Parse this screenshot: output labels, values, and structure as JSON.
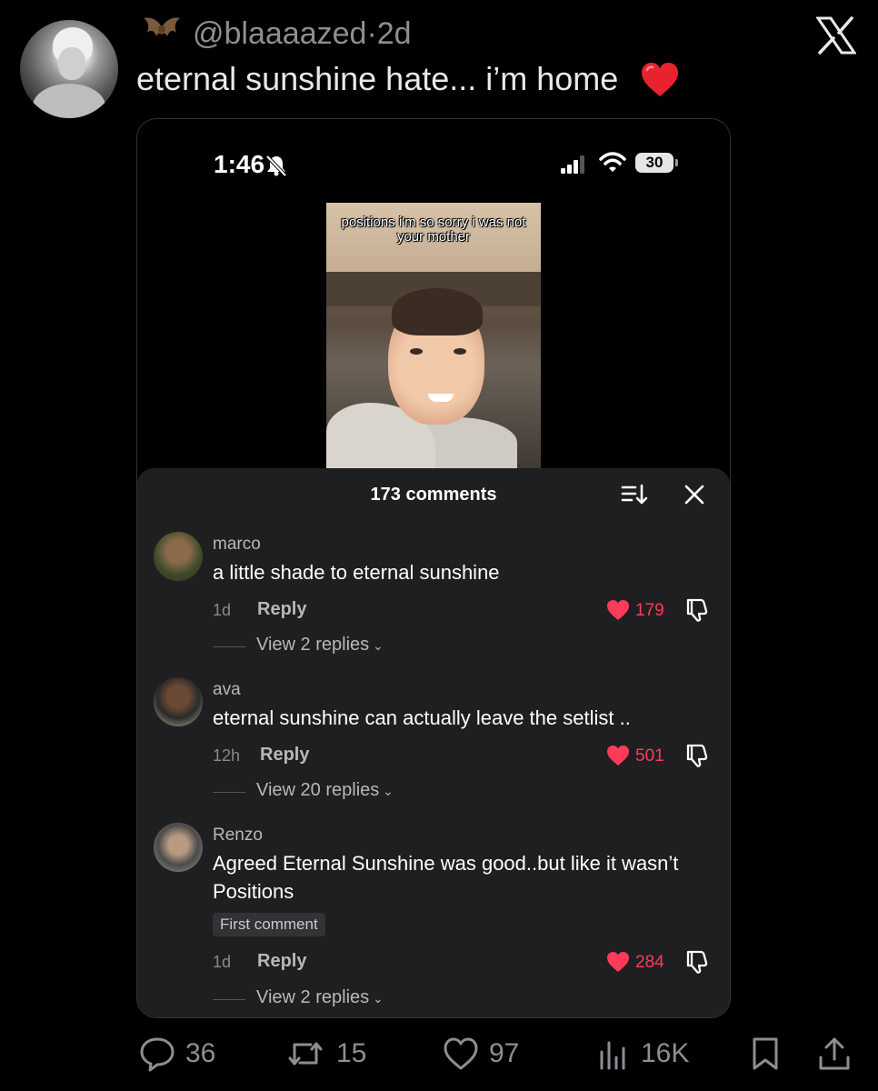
{
  "tweet": {
    "handle": "@blaaaazed",
    "separator": "·",
    "age": "2d",
    "text": "eternal sunshine hate... i’m home",
    "emoji_icon": "red-heart-emoji"
  },
  "screenshot": {
    "status_bar": {
      "time": "1:46",
      "battery": "30"
    },
    "video": {
      "caption": "positions i'm so sorry i was not your mother"
    },
    "comments_panel": {
      "count_label": "173 comments",
      "comments": [
        {
          "user": "marco",
          "text": "a little shade to eternal sunshine",
          "time": "1d",
          "reply_label": "Reply",
          "likes": "179",
          "view_replies": "View 2 replies"
        },
        {
          "user": "ava",
          "text": "eternal sunshine can actually leave the setlist ..",
          "time": "12h",
          "reply_label": "Reply",
          "likes": "501",
          "view_replies": "View 20 replies"
        },
        {
          "user": "Renzo",
          "text_line1": "Agreed Eternal Sunshine was good..but like it wasn’t",
          "text_line2": "Positions",
          "badge": "First comment",
          "time": "1d",
          "reply_label": "Reply",
          "likes": "284",
          "view_replies": "View 2 replies"
        }
      ]
    }
  },
  "actions": {
    "replies": "36",
    "retweets": "15",
    "likes": "97",
    "views": "16K"
  },
  "colors": {
    "background": "#000000",
    "panel": "#1f1f21",
    "like_red": "#ff3b5c",
    "muted": "#8b8f93"
  }
}
